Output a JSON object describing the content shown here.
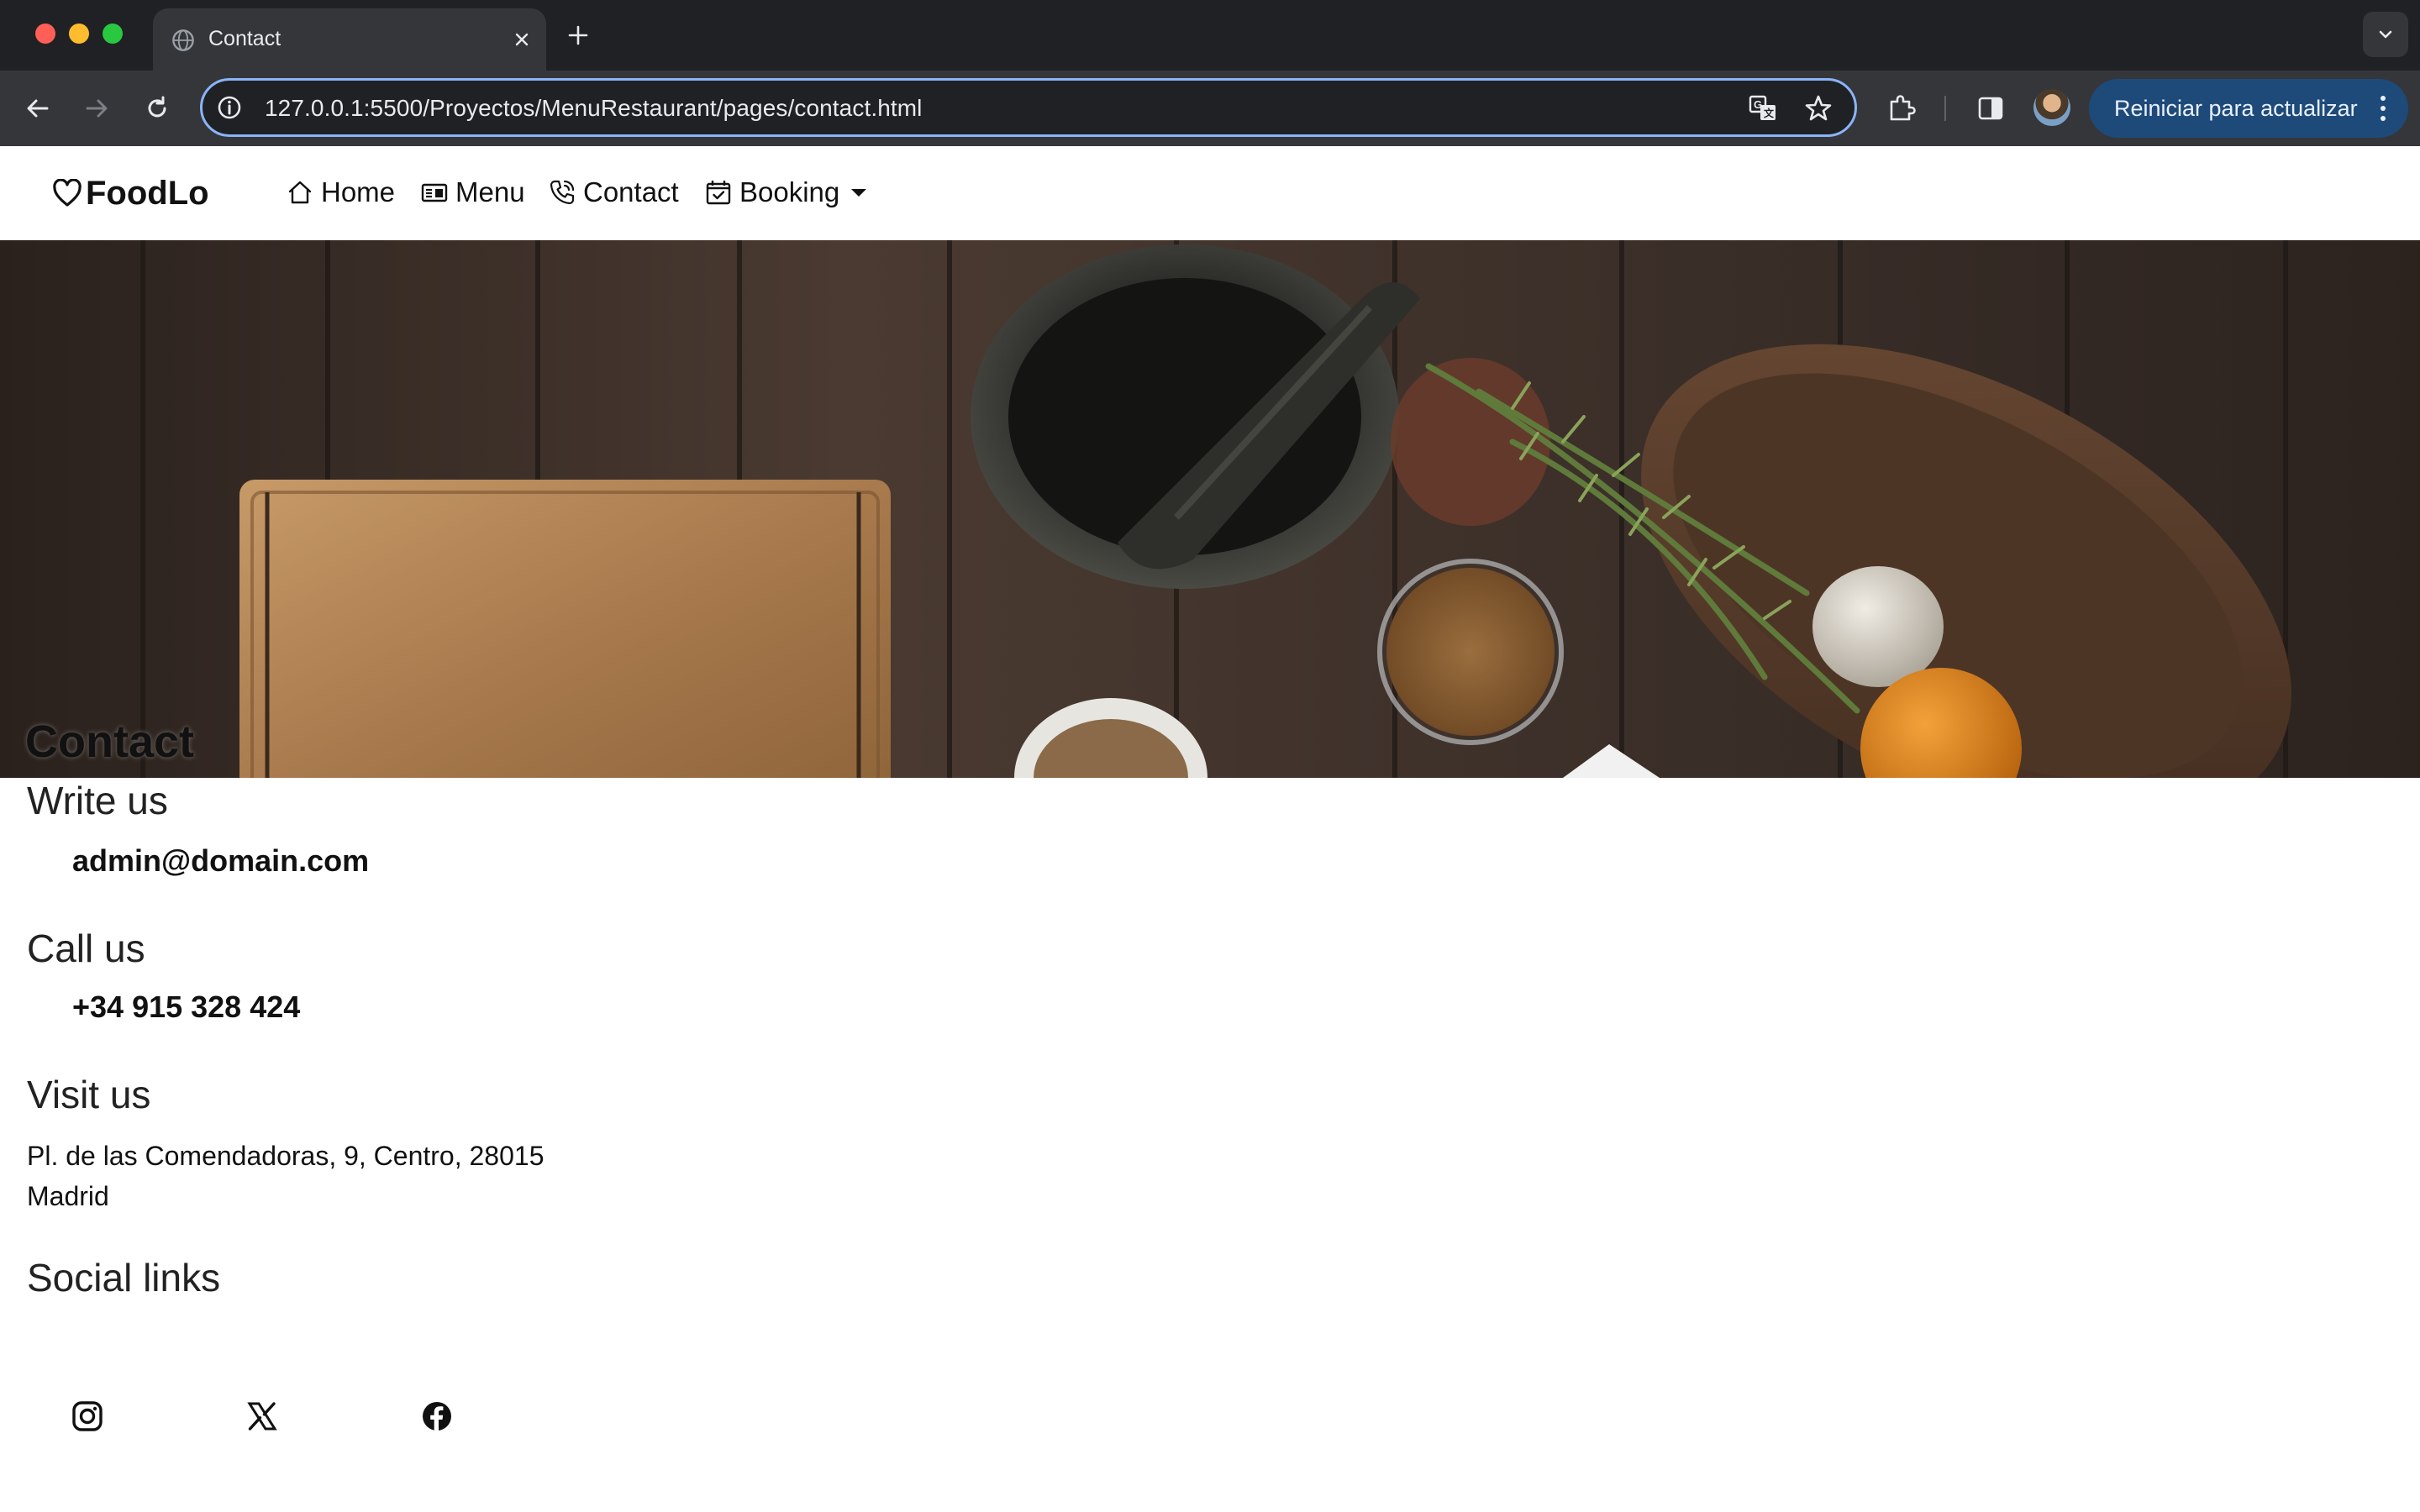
{
  "browser": {
    "tab_title": "Contact",
    "url": "127.0.0.1:5500/Proyectos/MenuRestaurant/pages/contact.html",
    "update_button": "Reiniciar para actualizar"
  },
  "navbar": {
    "brand": "FoodLo",
    "items": [
      {
        "label": "Home",
        "icon": "home-icon"
      },
      {
        "label": "Menu",
        "icon": "menu-card-icon"
      },
      {
        "label": "Contact",
        "icon": "phone-icon"
      },
      {
        "label": "Booking",
        "icon": "calendar-check-icon"
      }
    ]
  },
  "hero": {
    "title": "Contact"
  },
  "contact": {
    "write_title": "Write us",
    "email": "admin@domain.com",
    "call_title": "Call us",
    "phone": "+34 915 328 424",
    "visit_title": "Visit us",
    "address": "Pl. de las Comendadoras, 9, Centro, 28015 Madrid",
    "social_title": "Social links",
    "social": [
      "instagram-icon",
      "x-icon",
      "facebook-icon"
    ]
  }
}
